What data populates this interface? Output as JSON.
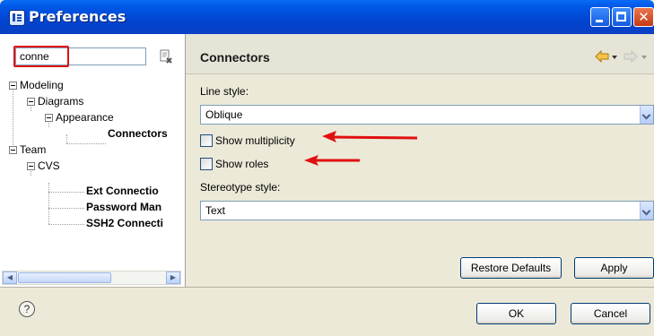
{
  "window": {
    "title": "Preferences"
  },
  "filter": {
    "value": "conne"
  },
  "tree": {
    "modeling": "Modeling",
    "diagrams": "Diagrams",
    "appearance": "Appearance",
    "connectors": "Connectors",
    "team": "Team",
    "cvs": "CVS",
    "ext_connection": "Ext Connectio",
    "password_management": "Password Man",
    "ssh2_connection": "SSH2 Connecti"
  },
  "page": {
    "title": "Connectors",
    "line_style_label": "Line style:",
    "line_style_value": "Oblique",
    "show_multiplicity": {
      "label": "Show multiplicity",
      "checked": false
    },
    "show_roles": {
      "label": "Show roles",
      "checked": false
    },
    "stereotype_style_label": "Stereotype style:",
    "stereotype_style_value": "Text",
    "restore_defaults": "Restore Defaults",
    "apply": "Apply"
  },
  "footer": {
    "ok": "OK",
    "cancel": "Cancel",
    "help_glyph": "?"
  },
  "icons": {
    "app": "preferences-app-icon",
    "clear": "clear-filter-icon",
    "back": "back-arrow-icon",
    "forward": "forward-arrow-icon",
    "help": "help-icon"
  },
  "colors": {
    "titlebar": "#0058e6",
    "annotation_arrow": "#e01010",
    "highlight_box": "#e01010",
    "nav_arrow": "#f3b01f"
  }
}
